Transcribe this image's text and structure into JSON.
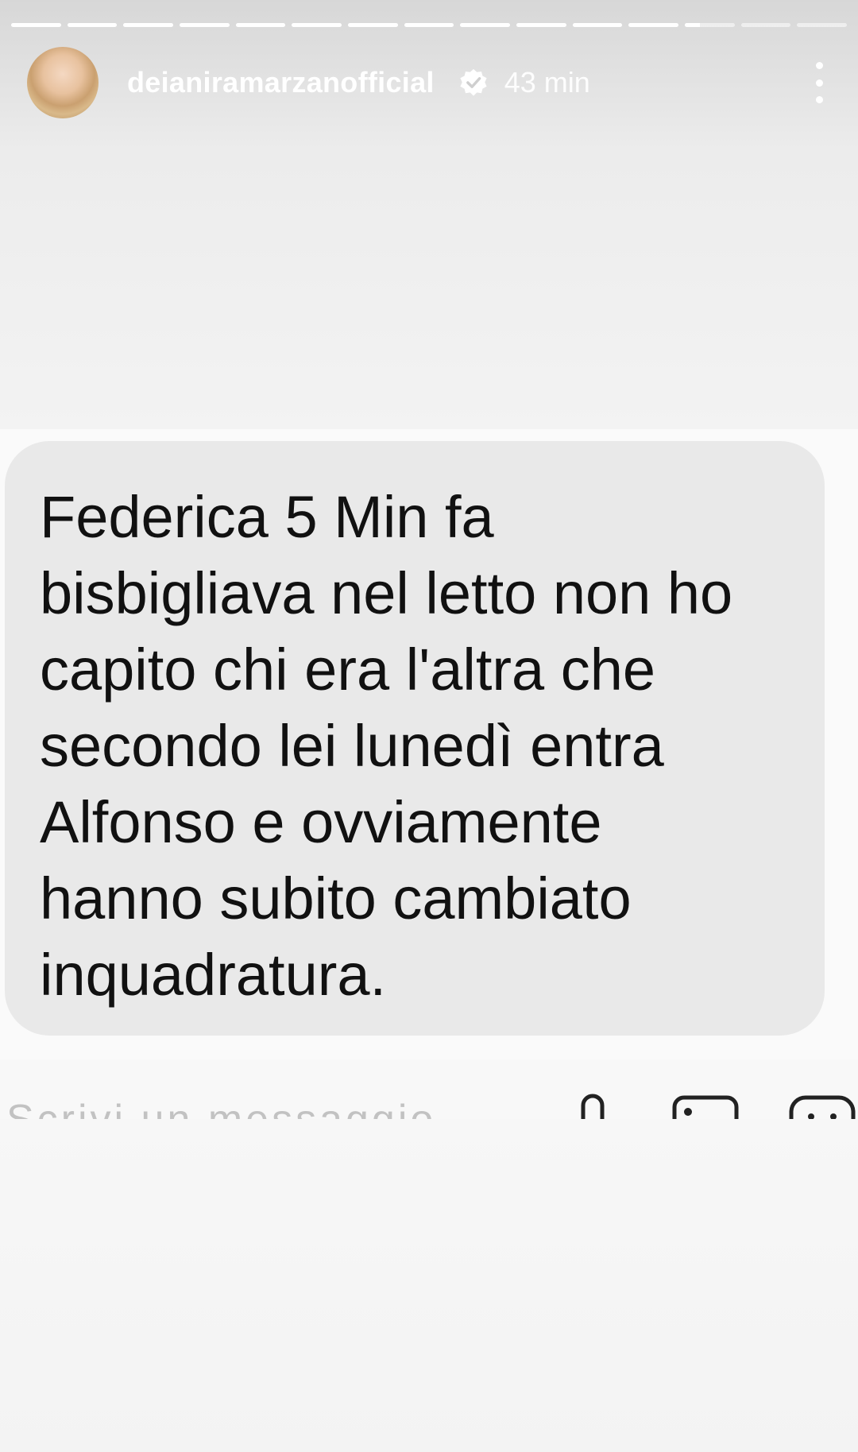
{
  "story": {
    "progress_segments": [
      1,
      1,
      1,
      1,
      1,
      1,
      1,
      1,
      1,
      1,
      1,
      1,
      0.3,
      0,
      0
    ],
    "username": "deianiramarzanofficial",
    "time": "43 min",
    "verified": true,
    "icons": {
      "verified": "verified-badge-icon",
      "more": "more-vertical-icon"
    }
  },
  "message": {
    "text": "Federica 5 Min fa\nbisbigliava nel letto non ho\ncapito chi era l'altra che\nsecondo lei lunedì entra\nAlfonso e ovviamente\nhanno subito cambiato\ninquadratura."
  },
  "composer": {
    "placeholder": "Scrivi un messaggio",
    "icons": [
      "microphone-icon",
      "image-icon",
      "sticker-icon"
    ]
  },
  "colors": {
    "bubble": "#e9e9e9",
    "text": "#111111",
    "header_text": "#ffffff"
  }
}
